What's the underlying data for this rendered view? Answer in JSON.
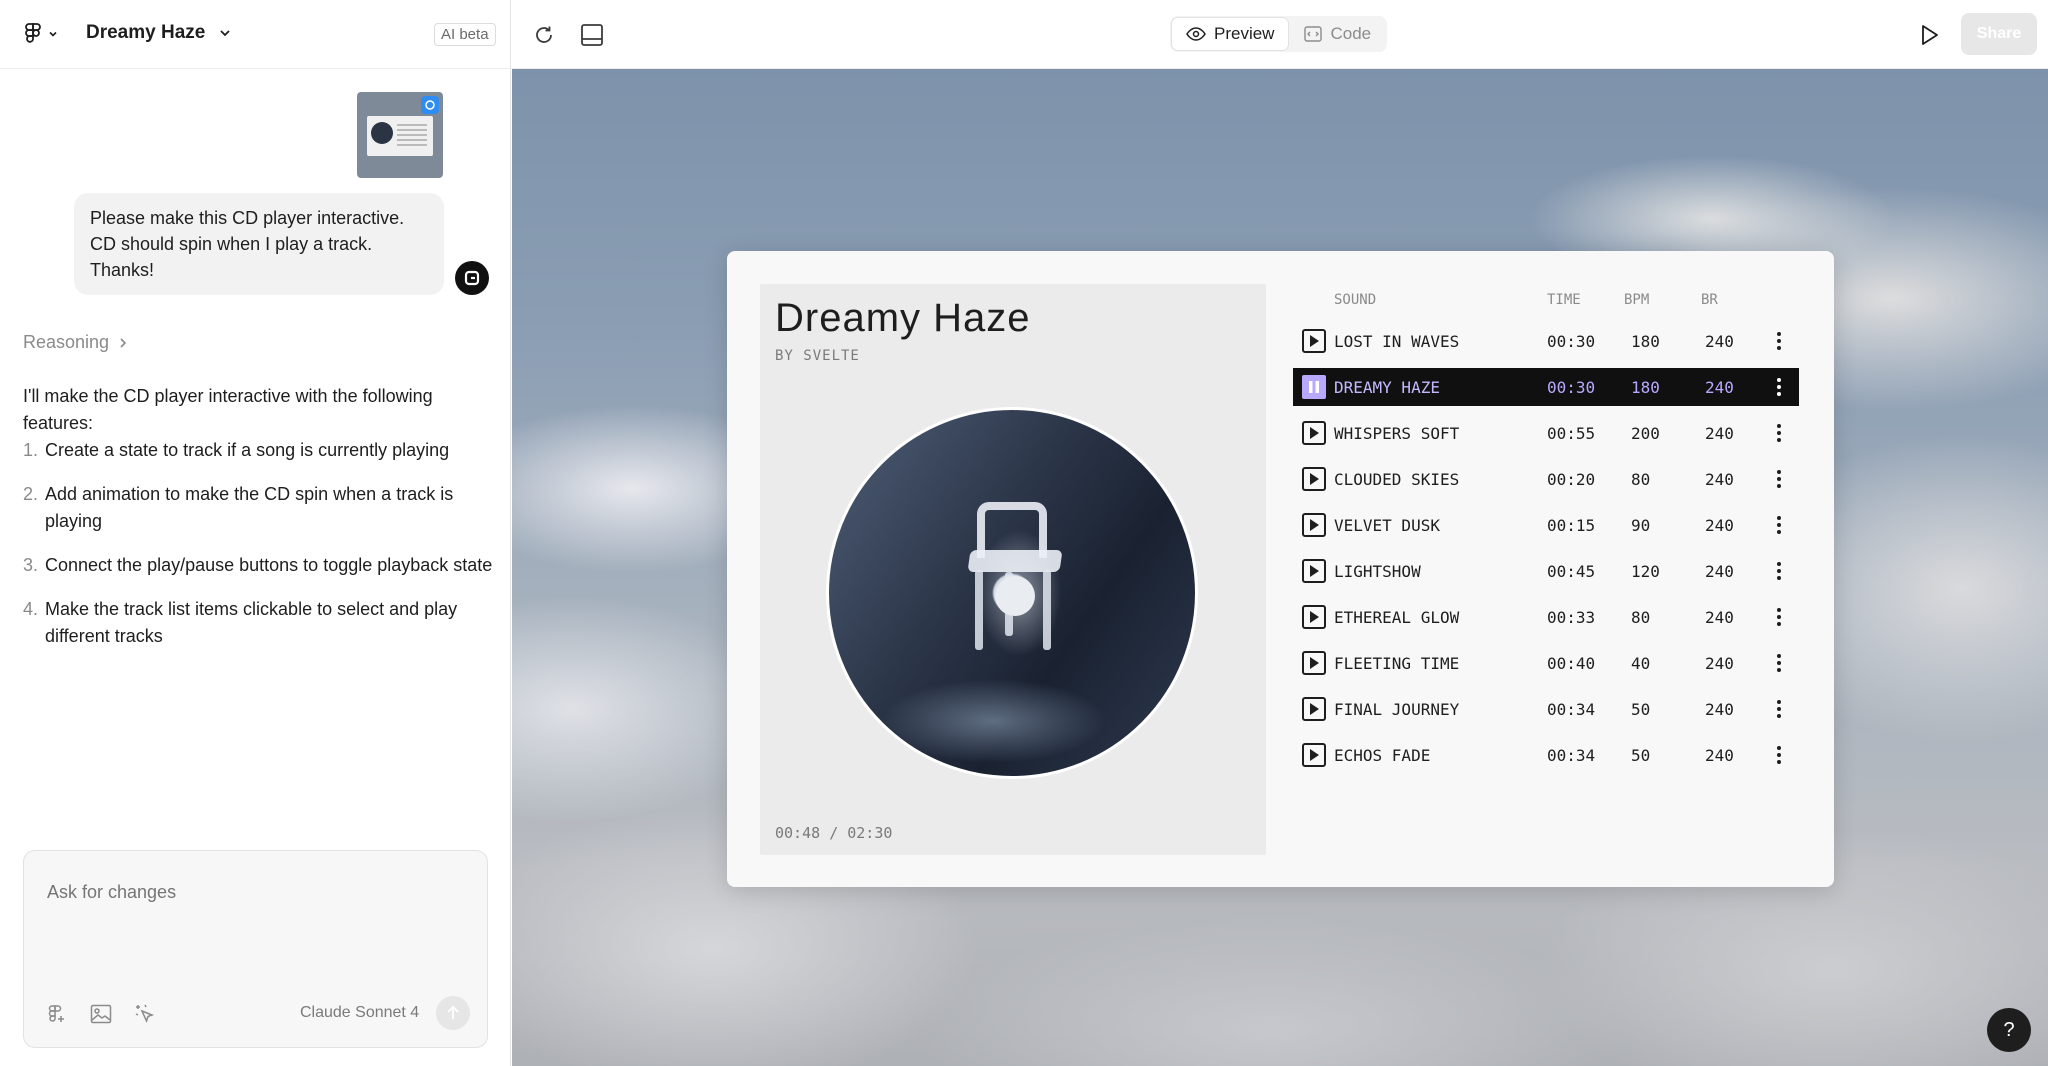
{
  "project": {
    "title": "Dreamy Haze",
    "ai_badge": "AI beta"
  },
  "chat": {
    "user_message": "Please make this CD player interactive. CD should spin when I play a track. Thanks!",
    "reasoning_label": "Reasoning",
    "reply_intro": "I'll make the CD player interactive with the following features:",
    "steps": [
      {
        "num": "1.",
        "text": "Create a state to track if a song is currently playing"
      },
      {
        "num": "2.",
        "text": "Add animation to make the CD spin when a track is playing"
      },
      {
        "num": "3.",
        "text": "Connect the play/pause buttons to toggle playback state"
      },
      {
        "num": "4.",
        "text": "Make the track list items clickable to select and play different tracks"
      }
    ],
    "composer_placeholder": "Ask for changes",
    "model": "Claude Sonnet 4"
  },
  "toolbar": {
    "preview_label": "Preview",
    "code_label": "Code",
    "share_label": "Share"
  },
  "player": {
    "album_title": "Dreamy Haze",
    "artist": "BY SVELTE",
    "elapsed": "00:48",
    "separator": "/",
    "duration": "02:30",
    "headers": {
      "sound": "SOUND",
      "time": "TIME",
      "bpm": "BPM",
      "br": "BR"
    },
    "tracks": [
      {
        "name": "LOST IN WAVES",
        "time": "00:30",
        "bpm": "180",
        "br": "240",
        "playing": false
      },
      {
        "name": "DREAMY HAZE",
        "time": "00:30",
        "bpm": "180",
        "br": "240",
        "playing": true
      },
      {
        "name": "WHISPERS SOFT",
        "time": "00:55",
        "bpm": "200",
        "br": "240",
        "playing": false
      },
      {
        "name": "CLOUDED SKIES",
        "time": "00:20",
        "bpm": "80",
        "br": "240",
        "playing": false
      },
      {
        "name": "VELVET DUSK",
        "time": "00:15",
        "bpm": "90",
        "br": "240",
        "playing": false
      },
      {
        "name": "LIGHTSHOW",
        "time": "00:45",
        "bpm": "120",
        "br": "240",
        "playing": false
      },
      {
        "name": "ETHEREAL GLOW",
        "time": "00:33",
        "bpm": "80",
        "br": "240",
        "playing": false
      },
      {
        "name": "FLEETING TIME",
        "time": "00:40",
        "bpm": "40",
        "br": "240",
        "playing": false
      },
      {
        "name": "FINAL JOURNEY",
        "time": "00:34",
        "bpm": "50",
        "br": "240",
        "playing": false
      },
      {
        "name": "ECHOS FADE",
        "time": "00:34",
        "bpm": "50",
        "br": "240",
        "playing": false
      }
    ]
  },
  "help_label": "?",
  "colors": {
    "active_row_bg": "#101010",
    "active_accent": "#b9a8ff",
    "badge_blue": "#2f8cf0"
  },
  "icons": [
    "figma-logo-icon",
    "chevron-down-icon",
    "image-attachment",
    "user-avatar-icon",
    "chevron-right-icon",
    "figma-component-icon",
    "image-icon",
    "cursor-sparkle-icon",
    "send-arrow-icon",
    "refresh-icon",
    "device-frame-icon",
    "eye-icon",
    "code-icon",
    "play-icon",
    "pause-icon",
    "more-vertical-icon",
    "help-icon"
  ]
}
